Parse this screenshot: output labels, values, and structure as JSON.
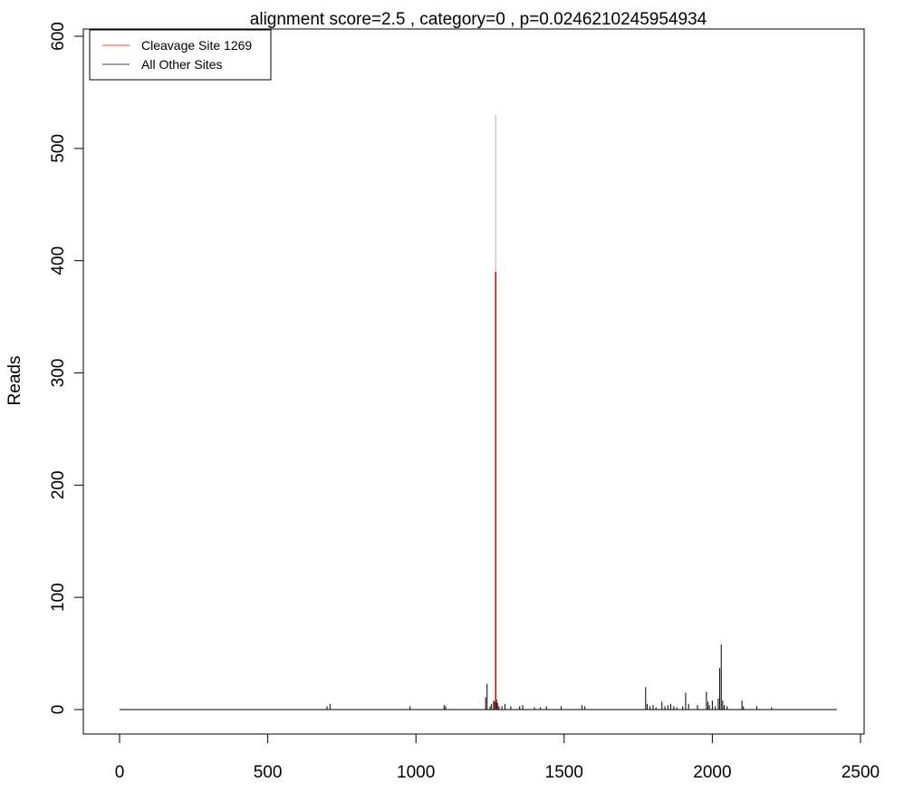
{
  "chart_data": {
    "type": "bar",
    "title": "alignment score=2.5 , category=0 , p=0.0246210245954934",
    "xlabel": "",
    "ylabel": "Reads",
    "xlim": [
      0,
      2500
    ],
    "ylim": [
      0,
      600
    ],
    "xticks": [
      0,
      500,
      1000,
      1500,
      2000,
      2500
    ],
    "yticks": [
      0,
      100,
      200,
      300,
      400,
      500,
      600
    ],
    "grid": false,
    "legend_position": "top-left",
    "baseline_x_range": [
      0,
      2420
    ],
    "series": [
      {
        "name": "Cleavage Site 1269",
        "color": "#ff0000",
        "x": [
          1269
        ],
        "values": [
          530
        ],
        "solid_to": 390
      },
      {
        "name": "All Other Sites",
        "color": "#000000",
        "x": [
          700,
          710,
          980,
          1095,
          1100,
          1235,
          1240,
          1250,
          1255,
          1262,
          1266,
          1272,
          1275,
          1280,
          1290,
          1300,
          1320,
          1350,
          1360,
          1400,
          1420,
          1440,
          1490,
          1560,
          1570,
          1775,
          1780,
          1790,
          1800,
          1810,
          1830,
          1840,
          1850,
          1860,
          1870,
          1880,
          1900,
          1910,
          1920,
          1950,
          1980,
          1985,
          1990,
          2000,
          2010,
          2020,
          2025,
          2030,
          2035,
          2040,
          2050,
          2100,
          2105,
          2150,
          2200
        ],
        "values": [
          3,
          5,
          3,
          4,
          3,
          11,
          23,
          3,
          5,
          8,
          7,
          9,
          6,
          3,
          3,
          5,
          3,
          3,
          4,
          2,
          2,
          3,
          3,
          4,
          3,
          20,
          5,
          3,
          4,
          2,
          7,
          3,
          4,
          5,
          3,
          2,
          3,
          15,
          5,
          4,
          16,
          7,
          4,
          8,
          3,
          10,
          37,
          58,
          8,
          4,
          3,
          8,
          3,
          3,
          2
        ]
      }
    ]
  }
}
